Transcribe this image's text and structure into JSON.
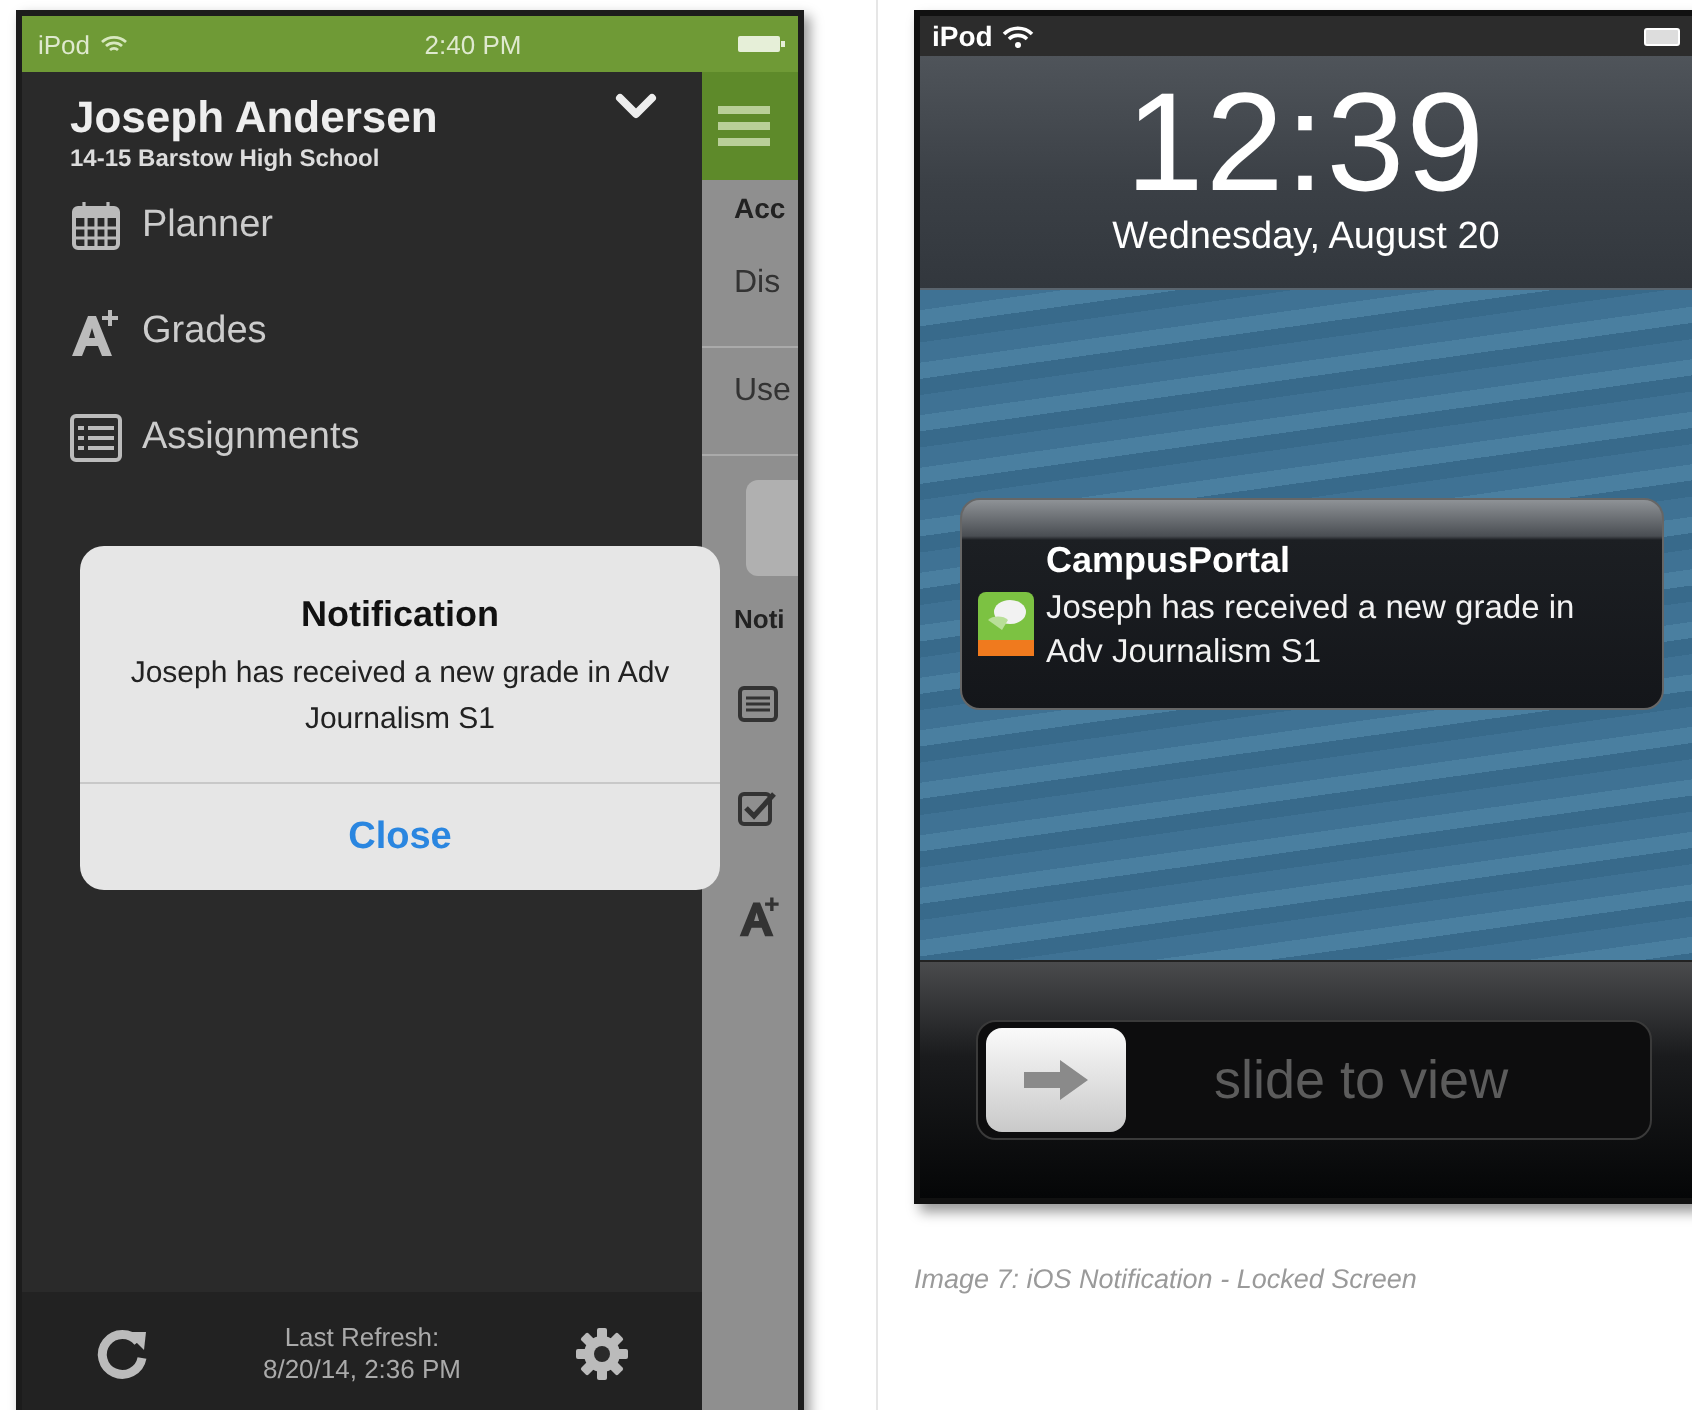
{
  "left_phone": {
    "status_bar": {
      "carrier": "iPod",
      "time": "2:40 PM"
    },
    "sidebar": {
      "user_name": "Joseph Andersen",
      "school": "14-15 Barstow High School",
      "items": [
        {
          "label": "Planner",
          "kind": "calendar"
        },
        {
          "label": "Grades",
          "kind": "grade"
        },
        {
          "label": "Assignments",
          "kind": "list"
        }
      ]
    },
    "content_peek": {
      "header": "Acc",
      "rows": [
        "Dis",
        "Use"
      ],
      "section": "Noti"
    },
    "alert": {
      "title": "Notification",
      "message": "Joseph has received a new grade in Adv Journalism S1",
      "button": "Close"
    },
    "footer": {
      "label": "Last Refresh:",
      "time": "8/20/14, 2:36 PM"
    }
  },
  "right_phone": {
    "status_bar": {
      "carrier": "iPod"
    },
    "clock": "12:39",
    "date": "Wednesday, August 20",
    "notification": {
      "app": "CampusPortal",
      "message": "Joseph has received a new grade in Adv Journalism S1"
    },
    "slider": {
      "label": "slide to view",
      "level": 0
    }
  },
  "caption": "Image 7: iOS Notification - Locked Screen"
}
